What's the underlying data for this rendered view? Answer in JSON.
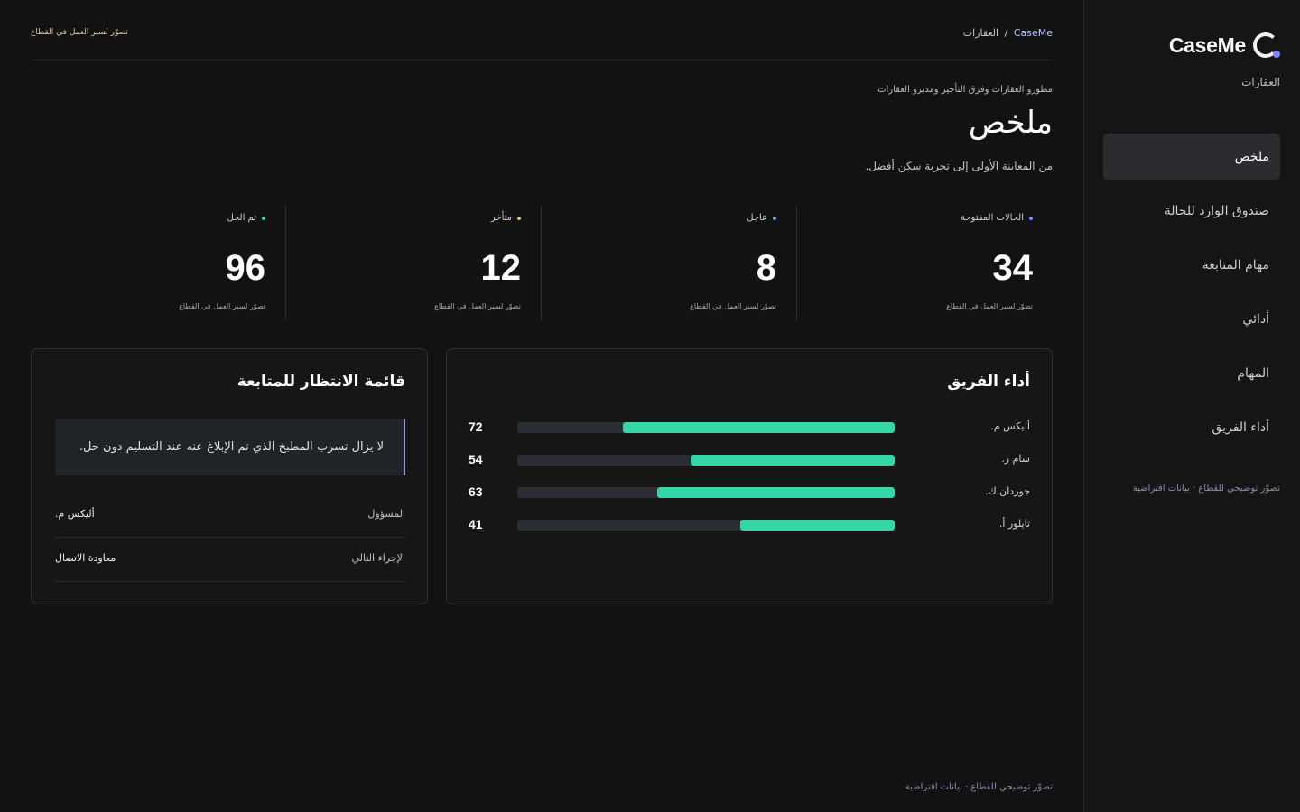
{
  "sidebar": {
    "brand_name": "CaseMe",
    "brand_sub": "العقارات",
    "items": [
      {
        "label": "ملخص",
        "active": true
      },
      {
        "label": "صندوق الوارد للحالة"
      },
      {
        "label": "مهام المتابعة"
      },
      {
        "label": "أدائي"
      },
      {
        "label": "المهام"
      },
      {
        "label": "أداء الفريق"
      }
    ],
    "footnote": "تصوّر توضيحي للقطاع · بيانات افتراضية"
  },
  "topbar": {
    "breadcrumb_root": "CaseMe",
    "breadcrumb_separator": "/",
    "breadcrumb_current": "العقارات",
    "note": "تصوّر لسير العمل في القطاع"
  },
  "header": {
    "eyebrow": "مطورو العقارات وفرق التأجير ومديرو العقارات",
    "title": "ملخص",
    "description": "من المعاينة الأولى إلى تجربة سكن أفضل."
  },
  "stats": [
    {
      "label": "الحالات المفتوحة",
      "value": "34",
      "caption": "تصوّر لسير العمل في القطاع",
      "dot_color": "#7b8cff"
    },
    {
      "label": "عاجل",
      "value": "8",
      "caption": "تصوّر لسير العمل في القطاع",
      "dot_color": "#6fa8dc"
    },
    {
      "label": "متأخر",
      "value": "12",
      "caption": "تصوّر لسير العمل في القطاع",
      "dot_color": "#e0c07a"
    },
    {
      "label": "تم الحل",
      "value": "96",
      "caption": "تصوّر لسير العمل في القطاع",
      "dot_color": "#35d6a6"
    }
  ],
  "team": {
    "title": "أداء الفريق",
    "accent": "#35d6a6",
    "rows": [
      {
        "name": "أليكس م.",
        "value": "72",
        "pct": 72
      },
      {
        "name": "سام ر.",
        "value": "54",
        "pct": 54
      },
      {
        "name": "جوردان ك.",
        "value": "63",
        "pct": 63
      },
      {
        "name": "تايلور أ.",
        "value": "41",
        "pct": 41
      }
    ]
  },
  "queue": {
    "title": "قائمة الانتظار للمتابعة",
    "callout": "لا يزال تسرب المطبخ الذي تم الإبلاغ عنه عند التسليم دون حل.",
    "rows": [
      {
        "key": "المسؤول",
        "value": "أليكس م."
      },
      {
        "key": "الإجراء التالي",
        "value": "معاودة الاتصال"
      }
    ]
  },
  "footer": {
    "note": "تصوّر توضيحي للقطاع · بيانات افتراضية"
  }
}
